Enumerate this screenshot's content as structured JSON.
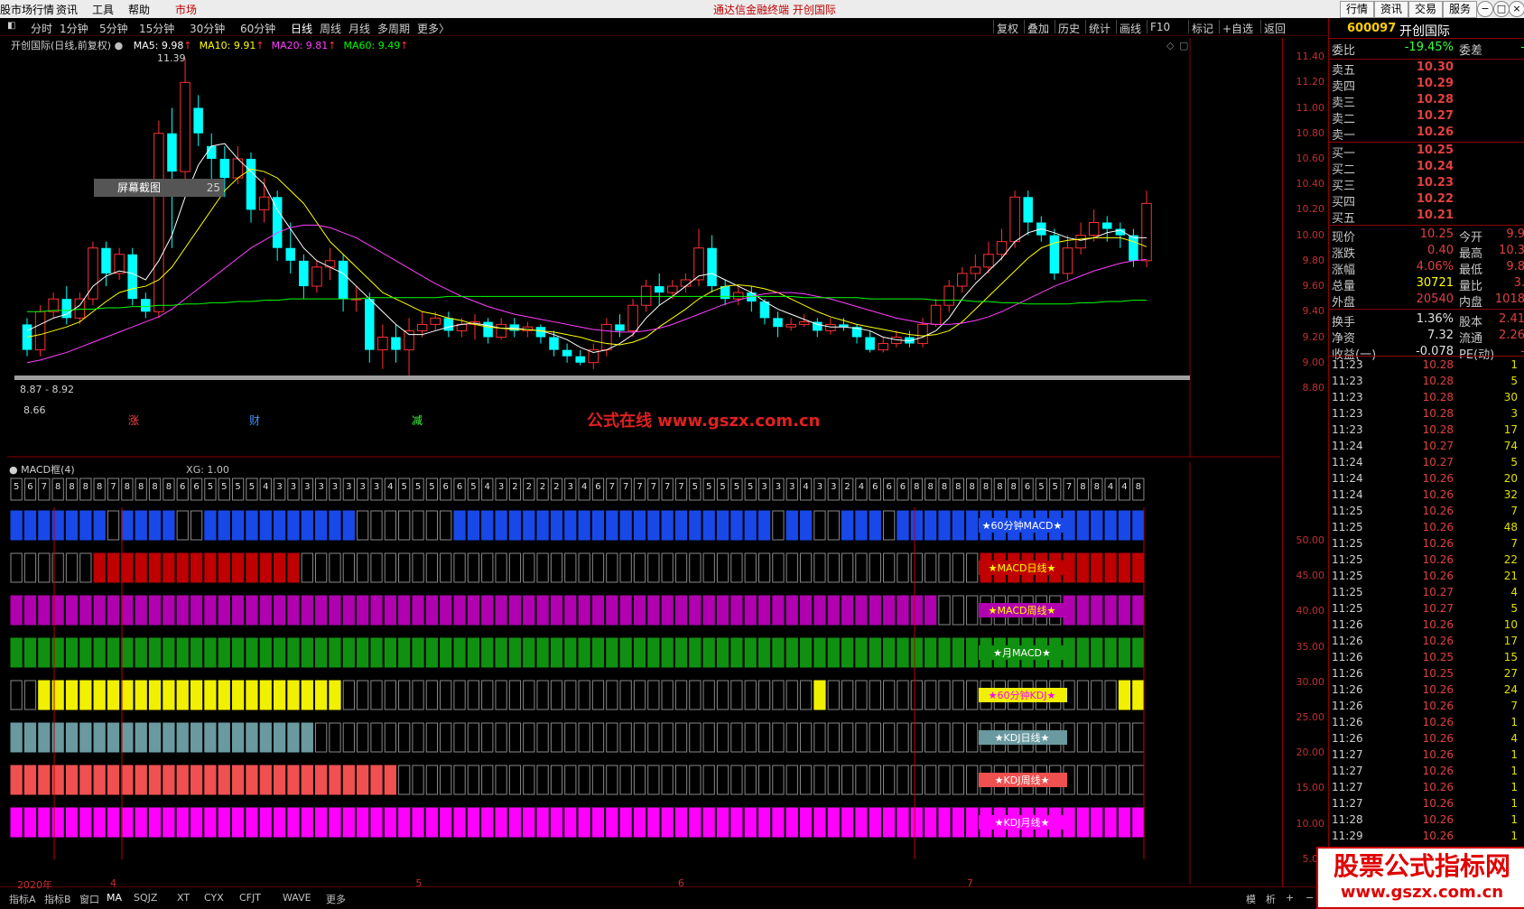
{
  "menubar": {
    "items": [
      "股市场行情",
      "资讯",
      "工具",
      "帮助",
      "市场"
    ],
    "caption": "通达信金融终端 开创国际",
    "right_buttons": [
      "行情",
      "资讯",
      "交易",
      "服务"
    ],
    "window_controls": [
      "−",
      "□",
      "×"
    ]
  },
  "toolbar": {
    "periods": [
      "分时",
      "1分钟",
      "5分钟",
      "15分钟",
      "30分钟",
      "60分钟",
      "日线",
      "周线",
      "月线",
      "多周期",
      "更多〉"
    ],
    "right_items": [
      "复权",
      "叠加",
      "历史",
      "统计",
      "画线",
      "F10",
      "标记",
      "+自选",
      "返回"
    ]
  },
  "main_chart": {
    "title": "开创国际(日线,前复权)",
    "ma": [
      {
        "label": "MA5: 9.98",
        "color": "#ffffff"
      },
      {
        "label": "MA10: 9.91",
        "color": "#ffff00"
      },
      {
        "label": "MA20: 9.81",
        "color": "#ff40ff"
      },
      {
        "label": "MA60: 9.49",
        "color": "#00ff00"
      }
    ],
    "high_label": "11.39",
    "low_label": "8.66",
    "range_label": "8.87 - 8.92",
    "screenshot_tip": "屏幕截图",
    "tip_suffix": "25",
    "markers": [
      {
        "text": "涨",
        "color": "#ff4040"
      },
      {
        "text": "财",
        "color": "#4090ff"
      },
      {
        "text": "减",
        "color": "#40ff40"
      }
    ],
    "watermark_text": "公式在线 www.gszx.com.cn",
    "price_axis": [
      "11.40",
      "11.20",
      "11.00",
      "10.80",
      "10.60",
      "10.40",
      "10.20",
      "10.00",
      "9.80",
      "9.60",
      "9.40",
      "9.20",
      "9.00",
      "8.80"
    ],
    "candles": [
      [
        9.3,
        9.1,
        9.35,
        9.05
      ],
      [
        9.1,
        9.4,
        9.45,
        9.05
      ],
      [
        9.4,
        9.5,
        9.55,
        9.35
      ],
      [
        9.5,
        9.35,
        9.6,
        9.3
      ],
      [
        9.35,
        9.5,
        9.55,
        9.3
      ],
      [
        9.5,
        9.9,
        9.95,
        9.45
      ],
      [
        9.9,
        9.7,
        9.95,
        9.6
      ],
      [
        9.7,
        9.85,
        9.9,
        9.65
      ],
      [
        9.85,
        9.5,
        9.9,
        9.45
      ],
      [
        9.5,
        9.4,
        9.55,
        9.35
      ],
      [
        9.4,
        10.8,
        10.9,
        9.35
      ],
      [
        10.8,
        10.5,
        11.0,
        9.9
      ],
      [
        10.5,
        11.2,
        11.39,
        10.4
      ],
      [
        11.0,
        10.8,
        11.1,
        10.7
      ],
      [
        10.7,
        10.6,
        10.8,
        10.4
      ],
      [
        10.6,
        10.45,
        10.7,
        10.3
      ],
      [
        10.45,
        10.6,
        10.7,
        10.4
      ],
      [
        10.6,
        10.2,
        10.65,
        10.1
      ],
      [
        10.2,
        10.3,
        10.45,
        10.1
      ],
      [
        10.3,
        9.9,
        10.35,
        9.8
      ],
      [
        9.9,
        9.8,
        10.1,
        9.7
      ],
      [
        9.8,
        9.6,
        9.85,
        9.5
      ],
      [
        9.6,
        9.75,
        9.8,
        9.55
      ],
      [
        9.75,
        9.8,
        9.9,
        9.65
      ],
      [
        9.8,
        9.5,
        9.85,
        9.4
      ],
      [
        9.5,
        9.5,
        9.6,
        9.4
      ],
      [
        9.5,
        9.1,
        9.55,
        9.0
      ],
      [
        9.1,
        9.2,
        9.3,
        8.95
      ],
      [
        9.2,
        9.1,
        9.3,
        9.0
      ],
      [
        9.1,
        9.25,
        9.35,
        8.9
      ],
      [
        9.25,
        9.3,
        9.4,
        9.2
      ],
      [
        9.3,
        9.35,
        9.4,
        9.25
      ],
      [
        9.35,
        9.25,
        9.4,
        9.2
      ],
      [
        9.25,
        9.3,
        9.35,
        9.2
      ],
      [
        9.3,
        9.32,
        9.38,
        9.18
      ],
      [
        9.32,
        9.2,
        9.35,
        9.15
      ],
      [
        9.2,
        9.3,
        9.35,
        9.18
      ],
      [
        9.3,
        9.25,
        9.35,
        9.2
      ],
      [
        9.25,
        9.28,
        9.32,
        9.2
      ],
      [
        9.28,
        9.2,
        9.3,
        9.15
      ],
      [
        9.2,
        9.1,
        9.25,
        9.05
      ],
      [
        9.1,
        9.05,
        9.15,
        9.0
      ],
      [
        9.05,
        9.0,
        9.1,
        8.98
      ],
      [
        9.0,
        9.1,
        9.15,
        8.95
      ],
      [
        9.1,
        9.3,
        9.35,
        9.05
      ],
      [
        9.3,
        9.25,
        9.38,
        9.2
      ],
      [
        9.25,
        9.45,
        9.5,
        9.2
      ],
      [
        9.45,
        9.6,
        9.65,
        9.4
      ],
      [
        9.6,
        9.55,
        9.7,
        9.45
      ],
      [
        9.55,
        9.6,
        9.65,
        9.5
      ],
      [
        9.6,
        9.65,
        9.7,
        9.55
      ],
      [
        9.65,
        9.9,
        10.05,
        9.6
      ],
      [
        9.9,
        9.6,
        10.0,
        9.55
      ],
      [
        9.6,
        9.5,
        9.65,
        9.45
      ],
      [
        9.5,
        9.55,
        9.6,
        9.45
      ],
      [
        9.55,
        9.48,
        9.6,
        9.4
      ],
      [
        9.48,
        9.35,
        9.5,
        9.3
      ],
      [
        9.35,
        9.28,
        9.4,
        9.2
      ],
      [
        9.28,
        9.3,
        9.35,
        9.25
      ],
      [
        9.3,
        9.32,
        9.38,
        9.28
      ],
      [
        9.32,
        9.25,
        9.35,
        9.2
      ],
      [
        9.25,
        9.3,
        9.35,
        9.22
      ],
      [
        9.3,
        9.28,
        9.35,
        9.25
      ],
      [
        9.28,
        9.2,
        9.3,
        9.15
      ],
      [
        9.2,
        9.1,
        9.25,
        9.08
      ],
      [
        9.1,
        9.15,
        9.2,
        9.08
      ],
      [
        9.15,
        9.2,
        9.25,
        9.12
      ],
      [
        9.2,
        9.15,
        9.25,
        9.12
      ],
      [
        9.15,
        9.3,
        9.35,
        9.12
      ],
      [
        9.3,
        9.45,
        9.5,
        9.28
      ],
      [
        9.45,
        9.6,
        9.65,
        9.4
      ],
      [
        9.6,
        9.7,
        9.75,
        9.55
      ],
      [
        9.7,
        9.75,
        9.85,
        9.65
      ],
      [
        9.75,
        9.85,
        9.95,
        9.7
      ],
      [
        9.85,
        9.95,
        10.05,
        9.8
      ],
      [
        9.95,
        10.3,
        10.35,
        9.9
      ],
      [
        10.3,
        10.1,
        10.35,
        10.0
      ],
      [
        10.1,
        10.0,
        10.15,
        9.95
      ],
      [
        10.0,
        9.7,
        10.05,
        9.65
      ],
      [
        9.7,
        9.9,
        10.0,
        9.65
      ],
      [
        9.9,
        10.0,
        10.1,
        9.85
      ],
      [
        10.0,
        10.1,
        10.2,
        9.95
      ],
      [
        10.1,
        10.05,
        10.15,
        9.95
      ],
      [
        10.05,
        10.0,
        10.1,
        9.9
      ],
      [
        10.0,
        9.8,
        10.05,
        9.75
      ],
      [
        9.8,
        10.25,
        10.35,
        9.75
      ]
    ],
    "ma5": [
      9.25,
      9.3,
      9.35,
      9.38,
      9.45,
      9.6,
      9.68,
      9.72,
      9.7,
      9.65,
      9.8,
      10.0,
      10.3,
      10.55,
      10.7,
      10.72,
      10.6,
      10.5,
      10.4,
      10.2,
      10.05,
      9.9,
      9.8,
      9.75,
      9.7,
      9.6,
      9.5,
      9.4,
      9.3,
      9.22,
      9.22,
      9.25,
      9.28,
      9.3,
      9.31,
      9.29,
      9.27,
      9.27,
      9.26,
      9.25,
      9.22,
      9.18,
      9.12,
      9.08,
      9.1,
      9.15,
      9.22,
      9.35,
      9.45,
      9.52,
      9.6,
      9.68,
      9.7,
      9.65,
      9.6,
      9.55,
      9.48,
      9.42,
      9.38,
      9.34,
      9.3,
      9.28,
      9.28,
      9.27,
      9.25,
      9.2,
      9.18,
      9.17,
      9.2,
      9.25,
      9.35,
      9.5,
      9.62,
      9.72,
      9.82,
      9.95,
      10.02,
      10.05,
      10.02,
      9.98,
      9.96,
      9.98,
      10.02,
      10.04,
      9.98,
      9.98
    ],
    "ma10": [
      9.2,
      9.22,
      9.25,
      9.28,
      9.32,
      9.4,
      9.48,
      9.55,
      9.58,
      9.6,
      9.65,
      9.75,
      9.9,
      10.05,
      10.2,
      10.35,
      10.45,
      10.52,
      10.5,
      10.45,
      10.35,
      10.25,
      10.1,
      9.95,
      9.85,
      9.75,
      9.65,
      9.55,
      9.5,
      9.45,
      9.4,
      9.38,
      9.35,
      9.33,
      9.3,
      9.28,
      9.27,
      9.26,
      9.26,
      9.25,
      9.24,
      9.22,
      9.2,
      9.17,
      9.15,
      9.14,
      9.16,
      9.2,
      9.28,
      9.35,
      9.42,
      9.5,
      9.56,
      9.6,
      9.61,
      9.6,
      9.58,
      9.55,
      9.5,
      9.45,
      9.4,
      9.36,
      9.33,
      9.3,
      9.28,
      9.26,
      9.24,
      9.22,
      9.21,
      9.22,
      9.25,
      9.32,
      9.42,
      9.52,
      9.62,
      9.72,
      9.82,
      9.9,
      9.94,
      9.96,
      9.97,
      9.98,
      9.98,
      9.98,
      9.95,
      9.91
    ],
    "ma20": [
      9.0,
      9.02,
      9.05,
      9.08,
      9.12,
      9.16,
      9.2,
      9.24,
      9.28,
      9.32,
      9.36,
      9.42,
      9.5,
      9.58,
      9.66,
      9.74,
      9.82,
      9.9,
      9.96,
      10.02,
      10.06,
      10.08,
      10.08,
      10.06,
      10.02,
      9.98,
      9.92,
      9.86,
      9.8,
      9.74,
      9.68,
      9.62,
      9.57,
      9.52,
      9.48,
      9.44,
      9.41,
      9.38,
      9.36,
      9.34,
      9.32,
      9.3,
      9.28,
      9.26,
      9.25,
      9.24,
      9.24,
      9.25,
      9.27,
      9.3,
      9.34,
      9.38,
      9.42,
      9.46,
      9.49,
      9.52,
      9.54,
      9.55,
      9.55,
      9.54,
      9.52,
      9.5,
      9.47,
      9.44,
      9.41,
      9.38,
      9.35,
      9.33,
      9.31,
      9.3,
      9.3,
      9.31,
      9.33,
      9.36,
      9.4,
      9.45,
      9.5,
      9.55,
      9.6,
      9.64,
      9.68,
      9.72,
      9.75,
      9.78,
      9.8,
      9.81
    ],
    "ma60": [
      9.4,
      9.4,
      9.41,
      9.41,
      9.42,
      9.42,
      9.43,
      9.43,
      9.44,
      9.44,
      9.45,
      9.45,
      9.46,
      9.46,
      9.47,
      9.47,
      9.48,
      9.48,
      9.49,
      9.49,
      9.5,
      9.5,
      9.5,
      9.5,
      9.5,
      9.5,
      9.51,
      9.51,
      9.51,
      9.51,
      9.51,
      9.51,
      9.52,
      9.52,
      9.52,
      9.52,
      9.52,
      9.52,
      9.52,
      9.52,
      9.52,
      9.52,
      9.52,
      9.52,
      9.52,
      9.52,
      9.52,
      9.52,
      9.52,
      9.52,
      9.52,
      9.52,
      9.52,
      9.52,
      9.52,
      9.52,
      9.52,
      9.52,
      9.52,
      9.51,
      9.51,
      9.51,
      9.51,
      9.51,
      9.5,
      9.5,
      9.5,
      9.5,
      9.5,
      9.49,
      9.49,
      9.49,
      9.48,
      9.48,
      9.47,
      9.47,
      9.46,
      9.46,
      9.46,
      9.46,
      9.47,
      9.47,
      9.48,
      9.48,
      9.49,
      9.49
    ]
  },
  "indicator": {
    "name": "MACD框(4)",
    "xg": "XG: 1.00",
    "axis": [
      "50.00",
      "45.00",
      "40.00",
      "35.00",
      "30.00",
      "25.00",
      "20.00",
      "15.00",
      "10.00",
      "5.00"
    ],
    "digits": "5678888788886655554333333334555665432222346777777555553334332466688888888655788448",
    "rows": [
      {
        "label": "★60分钟MACD★",
        "color": "#1848e8",
        "label_color": "#ffffff",
        "pattern": "1111111011110011111111111000000011111111111111111111111011001110111111111111111111111000000000011111000011111111111111111111111111111111110000000000000000001111111111111111111101000100000001010101010101010101010101010101010100101"
      },
      {
        "label": "★MACD日线★",
        "color": "#c00000",
        "label_color": "#ffff00",
        "pattern": "000000111111111111111000000000000000000000000000000000000000000000000011111111111111111111000000000000000000111111111111111111111100100"
      },
      {
        "label": "★MACD周线★",
        "color": "#b000b0",
        "label_color": "#ffff00",
        "pattern": "111111111111111111111111111111111111111111111111111111111111111111100000000011111111111111111111111111111111111111111111111111111111111111111110000011111111111111111111111111111111111"
      },
      {
        "label": "★月MACD★",
        "color": "#109010",
        "label_color": "#ffffff",
        "pattern": "11111111111111111111111111111111111111111111111111111111111111111111111111111111111111111111111111111111111111111111111111111111111111111111111111111111111111111111111"
      },
      {
        "label": "★60分钟KDJ★",
        "color": "#f0f000",
        "label_color": "#ff00ff",
        "pattern": "0011111111111111111111110000000000000000000000000000000000100000000000000000000011111111111100000000000000000000000000000000000001111111111111111011111011"
      },
      {
        "label": "★KDJ日线★",
        "color": "#6a9aa0",
        "label_color": "#ffffff",
        "pattern": "11111111111111111111110000000000000000000000000000000000000000000000000000000000000001111111111100000000000000000000000001111111111111111111111101"
      },
      {
        "label": "★KDJ周线★",
        "color": "#f05050",
        "label_color": "#ffffff",
        "pattern": "11111111111111111111111111110000000000000000000000000000000000000000000000000000000000000000000000000000000000000000000000000000000000000000000111111111111111111111111111111111"
      },
      {
        "label": "★KDJ月线★",
        "color": "#ff00ff",
        "label_color": "#ffffff",
        "pattern": "11111111111111111111111111111111111111111111111111111111111111111111111111111111111111111111111111111111111111111111111111111111111111111111111111111111111111111111111111111111"
      }
    ]
  },
  "dates": [
    {
      "text": "2020年",
      "pos": 0.005
    },
    {
      "text": "4",
      "pos": 0.078
    },
    {
      "text": "5",
      "pos": 0.318
    },
    {
      "text": "6",
      "pos": 0.524
    },
    {
      "text": "7",
      "pos": 0.751
    }
  ],
  "bottom_tabs": [
    "指标A",
    "指标B",
    "窗口",
    "MA",
    "SQJZ",
    "XT",
    "CYX",
    "CFJT",
    "WAVE",
    "更多"
  ],
  "bottom_right": [
    "模",
    "析",
    "+",
    "−"
  ],
  "quote": {
    "code": "600097",
    "name": "开创国际",
    "weibi_label": "委比",
    "weibi": "-19.45%",
    "weicha_label": "委差",
    "weicha": "-",
    "asks": [
      {
        "label": "卖五",
        "price": "10.30"
      },
      {
        "label": "卖四",
        "price": "10.29"
      },
      {
        "label": "卖三",
        "price": "10.28"
      },
      {
        "label": "卖二",
        "price": "10.27"
      },
      {
        "label": "卖一",
        "price": "10.26"
      }
    ],
    "bids": [
      {
        "label": "买一",
        "price": "10.25"
      },
      {
        "label": "买二",
        "price": "10.24"
      },
      {
        "label": "买三",
        "price": "10.23"
      },
      {
        "label": "买四",
        "price": "10.22"
      },
      {
        "label": "买五",
        "price": "10.21"
      }
    ],
    "stats": [
      {
        "k": "现价",
        "v": "10.25",
        "k2": "今开",
        "v2": "9.9"
      },
      {
        "k": "涨跌",
        "v": "0.40",
        "k2": "最高",
        "v2": "10.3"
      },
      {
        "k": "涨幅",
        "v": "4.06%",
        "k2": "最低",
        "v2": "9.8"
      },
      {
        "k": "总量",
        "v": "30721",
        "k2": "量比",
        "v2": "3."
      },
      {
        "k": "外盘",
        "v": "20540",
        "k2": "内盘",
        "v2": "1018"
      },
      {
        "k": "换手",
        "v": "1.36%",
        "k2": "股本",
        "v2": "2.41"
      },
      {
        "k": "净资",
        "v": "7.32",
        "k2": "流通",
        "v2": "2.26"
      },
      {
        "k": "收益(一)",
        "v": "-0.078",
        "k2": "PE(动)",
        "v2": "-"
      }
    ],
    "ticks": [
      [
        "11:23",
        "10.28",
        "1"
      ],
      [
        "11:23",
        "10.28",
        "5"
      ],
      [
        "11:23",
        "10.28",
        "30"
      ],
      [
        "11:23",
        "10.28",
        "3"
      ],
      [
        "11:23",
        "10.28",
        "17"
      ],
      [
        "11:24",
        "10.27",
        "74"
      ],
      [
        "11:24",
        "10.27",
        "5"
      ],
      [
        "11:24",
        "10.26",
        "20"
      ],
      [
        "11:24",
        "10.26",
        "32"
      ],
      [
        "11:25",
        "10.26",
        "7"
      ],
      [
        "11:25",
        "10.26",
        "48"
      ],
      [
        "11:25",
        "10.26",
        "7"
      ],
      [
        "11:25",
        "10.26",
        "22"
      ],
      [
        "11:25",
        "10.26",
        "21"
      ],
      [
        "11:25",
        "10.27",
        "4"
      ],
      [
        "11:25",
        "10.27",
        "5"
      ],
      [
        "11:26",
        "10.26",
        "10"
      ],
      [
        "11:26",
        "10.26",
        "17"
      ],
      [
        "11:26",
        "10.25",
        "15"
      ],
      [
        "11:26",
        "10.25",
        "27"
      ],
      [
        "11:26",
        "10.26",
        "24"
      ],
      [
        "11:26",
        "10.26",
        "7"
      ],
      [
        "11:26",
        "10.26",
        "1"
      ],
      [
        "11:26",
        "10.26",
        "4"
      ],
      [
        "11:27",
        "10.26",
        "1"
      ],
      [
        "11:27",
        "10.26",
        "1"
      ],
      [
        "11:27",
        "10.26",
        "1"
      ],
      [
        "11:27",
        "10.26",
        "1"
      ],
      [
        "11:28",
        "10.26",
        "1"
      ],
      [
        "11:29",
        "10.26",
        "1"
      ]
    ],
    "period_label": "日线"
  },
  "brand": {
    "title": "股票公式指标网",
    "url": "www.gszx.com.cn"
  }
}
